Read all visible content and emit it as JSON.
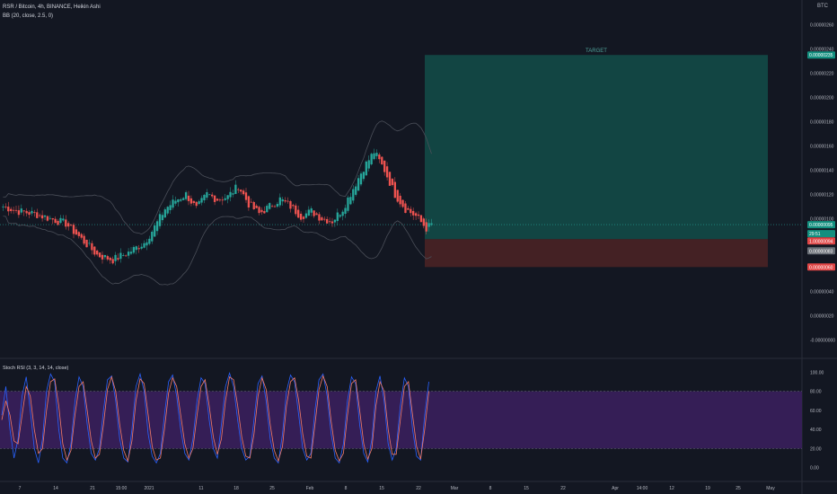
{
  "header": {
    "symbol_line": "RSR / Bitcoin, 4h, BINANCE, Heikin Ashi",
    "bb_line": "BB (20, close, 2.5, 0)",
    "currency": "BTC"
  },
  "colors": {
    "background": "#131722",
    "up_candle": "#26a69a",
    "down_candle": "#ef5350",
    "target_zone": "#134e49",
    "stop_zone": "#4a2225",
    "stoch_band": "#3a1f5c",
    "k_line": "#2962ff",
    "d_line": "#f57c6a",
    "bb_line": "#4a4e58"
  },
  "chart_data": [
    {
      "type": "candlestick",
      "title": "RSR / Bitcoin, 4h, BINANCE, Heikin Ashi",
      "indicator": "BB (20, close, 2.5, 0)",
      "ylim": [
        -5e-08,
        2.7e-06
      ],
      "y_ticks": [
        "0.00000260",
        "0.00000240",
        "0.00000220",
        "0.00000200",
        "0.00000180",
        "0.00000160",
        "0.00000140",
        "0.00000120",
        "0.00000100",
        "0.00000060",
        "0.00000040",
        "0.00000020",
        "-0.00000000"
      ],
      "price_labels": [
        {
          "text": "0.00000235",
          "kind": "target"
        },
        {
          "text": "0.00000095",
          "kind": "last"
        },
        {
          "text": "29:51",
          "kind": "last"
        },
        {
          "text": "1.00000094",
          "kind": "stop"
        },
        {
          "text": "0.00000083",
          "kind": "stop"
        },
        {
          "text": "0.00000060",
          "kind": "stop"
        }
      ],
      "position_tool": {
        "label": "TARGET",
        "entry": 8.3e-07,
        "target": 2.35e-06,
        "stop": 6e-07
      },
      "price_path": [
        [
          0,
          1.1e-06
        ],
        [
          6,
          1.06e-06
        ],
        [
          12,
          1.04e-06
        ],
        [
          18,
          1e-06
        ],
        [
          24,
          9.6e-07
        ],
        [
          30,
          8.3e-07
        ],
        [
          36,
          7e-07
        ],
        [
          42,
          6.6e-07
        ],
        [
          48,
          7.2e-07
        ],
        [
          54,
          8e-07
        ],
        [
          58,
          9.3e-07
        ],
        [
          62,
          1.08e-06
        ],
        [
          66,
          1.15e-06
        ],
        [
          70,
          1.2e-06
        ],
        [
          74,
          1.08e-06
        ],
        [
          78,
          1.2e-06
        ],
        [
          82,
          1.16e-06
        ],
        [
          86,
          1.18e-06
        ],
        [
          90,
          1.27e-06
        ],
        [
          94,
          1.12e-06
        ],
        [
          98,
          1.04e-06
        ],
        [
          102,
          1.1e-06
        ],
        [
          106,
          1.16e-06
        ],
        [
          110,
          1.1e-06
        ],
        [
          114,
          1.02e-06
        ],
        [
          118,
          1.06e-06
        ],
        [
          122,
          1e-06
        ],
        [
          126,
          9.8e-07
        ],
        [
          130,
          1.08e-06
        ],
        [
          134,
          1.25e-06
        ],
        [
          138,
          1.42e-06
        ],
        [
          142,
          1.55e-06
        ],
        [
          146,
          1.4e-06
        ],
        [
          150,
          1.2e-06
        ],
        [
          154,
          1.08e-06
        ],
        [
          158,
          1.02e-06
        ],
        [
          162,
          9.2e-07
        ],
        [
          164,
          9.5e-07
        ]
      ],
      "x_ticks": [
        "7",
        "14",
        "21",
        "15:00",
        "2021",
        "11",
        "18",
        "25",
        "Feb",
        "8",
        "15",
        "22",
        "Mar",
        "8",
        "15",
        "22",
        "Apr",
        "14:00",
        "12",
        "19",
        "25",
        "May"
      ]
    },
    {
      "type": "line",
      "title": "Stoch RSI (3, 3, 14, 14, close)",
      "ylim": [
        -5,
        105
      ],
      "y_ticks": [
        "100.00",
        "80.00",
        "60.00",
        "40.00",
        "20.00",
        "0.00"
      ],
      "band": [
        20,
        80
      ],
      "series": [
        {
          "name": "K",
          "values": [
            55,
            85,
            40,
            10,
            30,
            75,
            95,
            60,
            20,
            5,
            30,
            80,
            98,
            90,
            40,
            10,
            5,
            25,
            70,
            95,
            85,
            45,
            15,
            8,
            20,
            60,
            92,
            96,
            70,
            30,
            10,
            6,
            40,
            85,
            98,
            80,
            35,
            12,
            5,
            15,
            55,
            90,
            97,
            75,
            40,
            15,
            8,
            30,
            70,
            94,
            88,
            50,
            20,
            10,
            45,
            85,
            99,
            85,
            50,
            20,
            8,
            12,
            50,
            88,
            96,
            70,
            30,
            10,
            5,
            35,
            80,
            97,
            90,
            55,
            20,
            8,
            15,
            60,
            92,
            98,
            75,
            35,
            10,
            5,
            25,
            70,
            95,
            88,
            45,
            15,
            6,
            30,
            80,
            96,
            70,
            25,
            8,
            20,
            65,
            94,
            85,
            40,
            12,
            8,
            55,
            90
          ]
        },
        {
          "name": "D",
          "values": [
            50,
            70,
            55,
            28,
            25,
            55,
            85,
            75,
            40,
            15,
            20,
            60,
            90,
            93,
            65,
            25,
            8,
            18,
            55,
            85,
            90,
            60,
            28,
            10,
            14,
            45,
            82,
            95,
            80,
            45,
            18,
            7,
            28,
            70,
            93,
            88,
            55,
            22,
            8,
            10,
            40,
            78,
            94,
            85,
            55,
            25,
            10,
            20,
            55,
            85,
            92,
            65,
            32,
            14,
            30,
            70,
            95,
            92,
            65,
            32,
            12,
            10,
            35,
            75,
            94,
            82,
            45,
            18,
            7,
            22,
            65,
            90,
            94,
            70,
            35,
            12,
            10,
            45,
            82,
            96,
            85,
            48,
            18,
            7,
            15,
            55,
            88,
            92,
            60,
            25,
            9,
            20,
            65,
            90,
            80,
            40,
            14,
            14,
            50,
            85,
            90,
            55,
            22,
            9,
            40,
            80
          ]
        }
      ],
      "x_ticks": [
        "7",
        "14",
        "21",
        "15:00",
        "2021",
        "11",
        "18",
        "25",
        "Feb",
        "8",
        "15",
        "22",
        "Mar",
        "8",
        "15",
        "22",
        "Apr",
        "14:00",
        "12",
        "19",
        "25",
        "May"
      ]
    }
  ]
}
